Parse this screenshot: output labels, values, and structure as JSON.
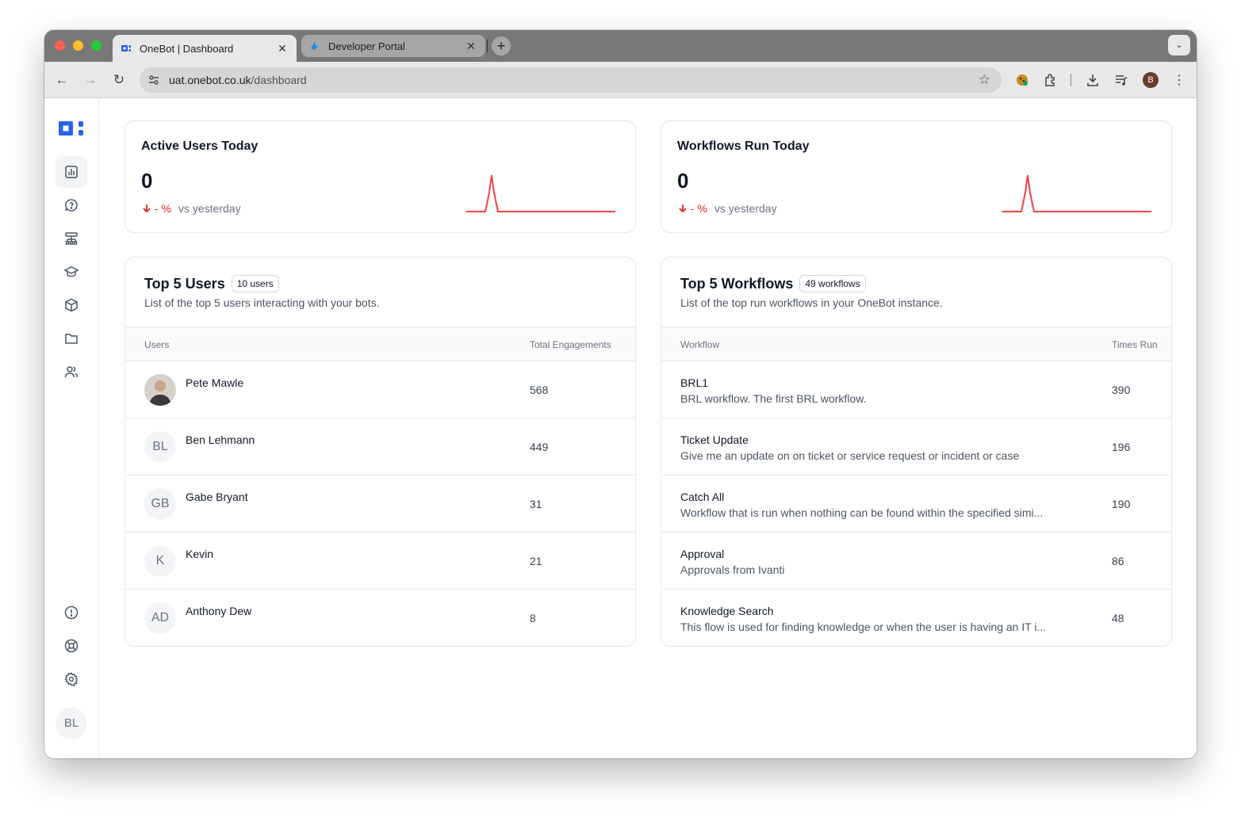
{
  "browser": {
    "tabs": [
      {
        "title": "OneBot | Dashboard",
        "active": true
      },
      {
        "title": "Developer Portal",
        "active": false
      }
    ],
    "new_tab_label": "+",
    "url_host": "uat.onebot.co.uk",
    "url_path": "/dashboard",
    "profile_initial": "B"
  },
  "sidebar": {
    "items": [
      "dashboard-icon",
      "chat-question-icon",
      "workflow-icon",
      "training-icon",
      "package-icon",
      "folder-icon",
      "users-icon"
    ],
    "bottom_items": [
      "alert-icon",
      "support-icon",
      "settings-icon"
    ],
    "avatar_initials": "BL"
  },
  "stats": [
    {
      "title": "Active Users Today",
      "value": "0",
      "change": "- %",
      "compare": "vs yesterday"
    },
    {
      "title": "Workflows Run Today",
      "value": "0",
      "change": "- %",
      "compare": "vs yesterday"
    }
  ],
  "top_users": {
    "title": "Top 5 Users",
    "badge": "10 users",
    "subtitle": "List of the top 5 users interacting with your bots.",
    "col_users": "Users",
    "col_engagements": "Total Engagements",
    "rows": [
      {
        "initials": "",
        "name": "Pete Mawle",
        "value": "568"
      },
      {
        "initials": "BL",
        "name": "Ben Lehmann",
        "value": "449"
      },
      {
        "initials": "GB",
        "name": "Gabe Bryant",
        "value": "31"
      },
      {
        "initials": "K",
        "name": "Kevin",
        "value": "21"
      },
      {
        "initials": "AD",
        "name": "Anthony Dew",
        "value": "8"
      }
    ]
  },
  "top_workflows": {
    "title": "Top 5 Workflows",
    "badge": "49 workflows",
    "subtitle": "List of the top run workflows in your OneBot instance.",
    "col_workflow": "Workflow",
    "col_times": "Times Run",
    "rows": [
      {
        "name": "BRL1",
        "desc": "BRL workflow. The first BRL workflow.",
        "value": "390"
      },
      {
        "name": "Ticket Update",
        "desc": "Give me an update on on ticket or service request or incident or case",
        "value": "196"
      },
      {
        "name": "Catch All",
        "desc": "Workflow that is run when nothing can be found within the specified simi...",
        "value": "190"
      },
      {
        "name": "Approval",
        "desc": "Approvals from Ivanti",
        "value": "86"
      },
      {
        "name": "Knowledge Search",
        "desc": "This flow is used for finding knowledge or when the user is having an IT i...",
        "value": "48"
      }
    ]
  },
  "colors": {
    "accent": "#2563eb",
    "negative": "#dc2626",
    "spark": "#ef4444"
  }
}
